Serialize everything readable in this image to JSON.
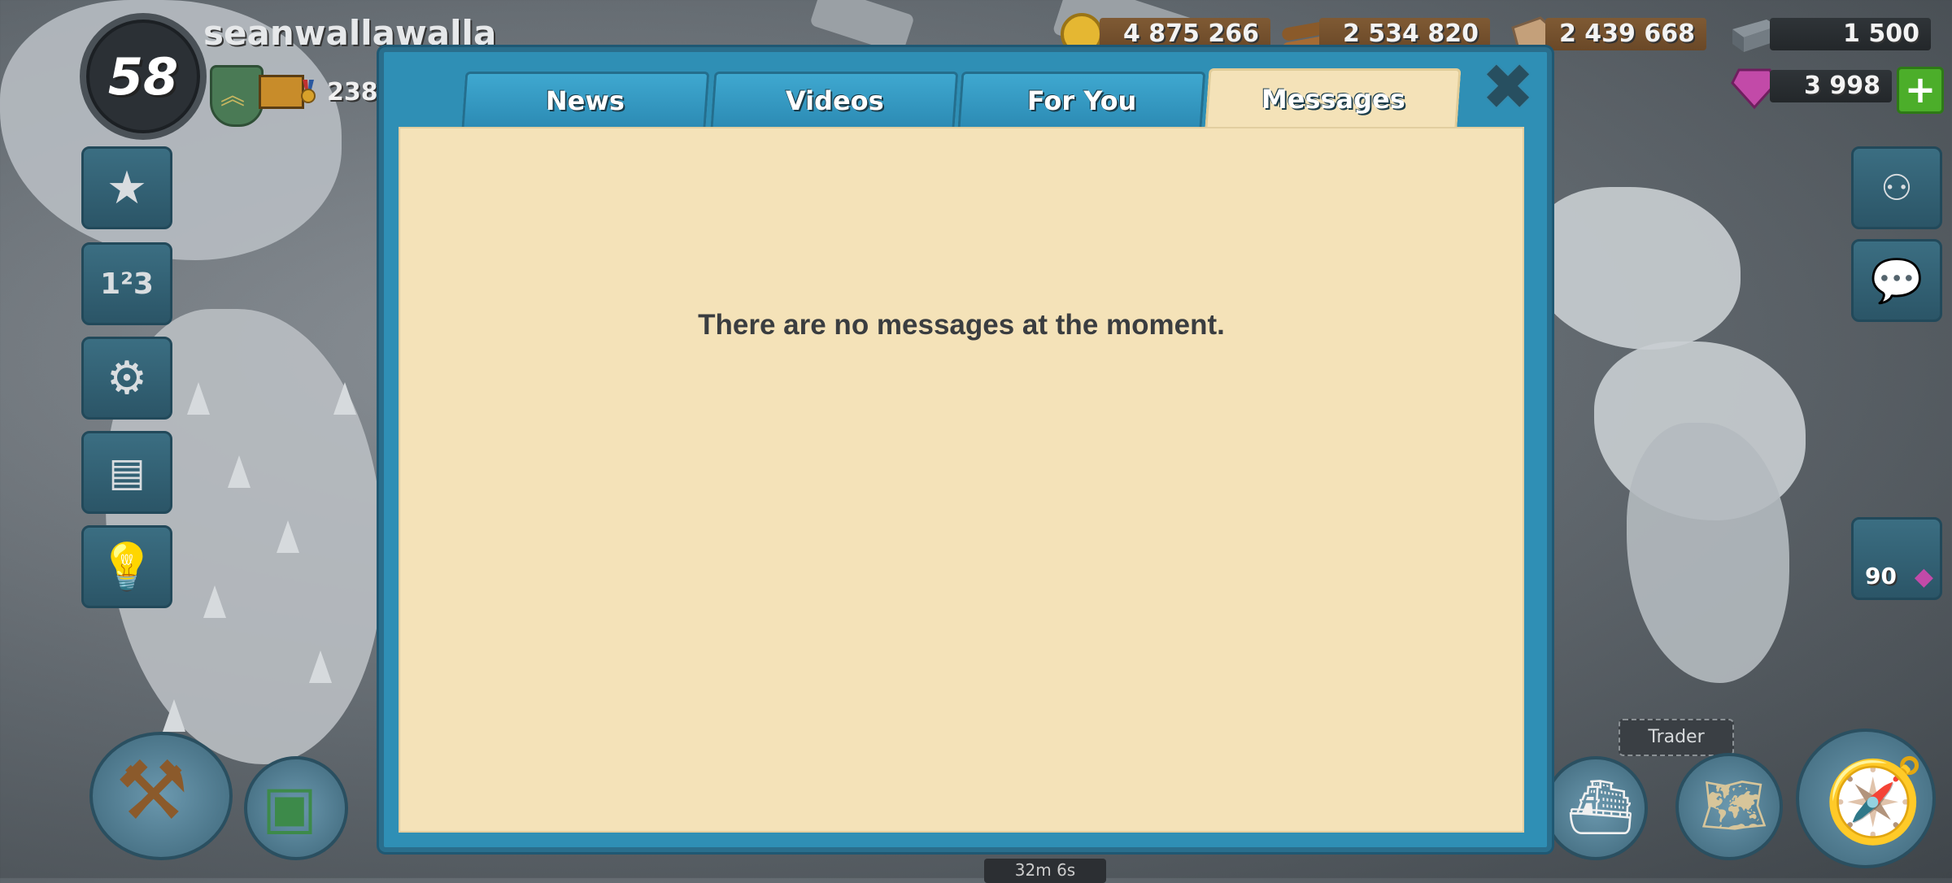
{
  "player": {
    "name": "seanwallawalla",
    "level": "58",
    "medals": "238"
  },
  "resources": {
    "gold": "4 875 266",
    "wood": "2 534 820",
    "stone": "2 439 668",
    "iron": "1 500",
    "diamonds": "3 998"
  },
  "side_buttons": [
    "star-icon",
    "leaderboard-icon",
    "settings-icon",
    "newspaper-icon",
    "lightbulb-icon"
  ],
  "right_panel": {
    "gem_count": "90",
    "trader_label": "Trader",
    "timer": "32m 6s"
  },
  "modal": {
    "tabs": [
      "News",
      "Videos",
      "For You",
      "Messages"
    ],
    "active_tab": "Messages",
    "empty_message": "There are no messages at the moment."
  },
  "colors": {
    "modal_blue": "#2f8fb5",
    "panel_cream": "#f4e2b8",
    "tab_blue": "#3fa8d0"
  }
}
